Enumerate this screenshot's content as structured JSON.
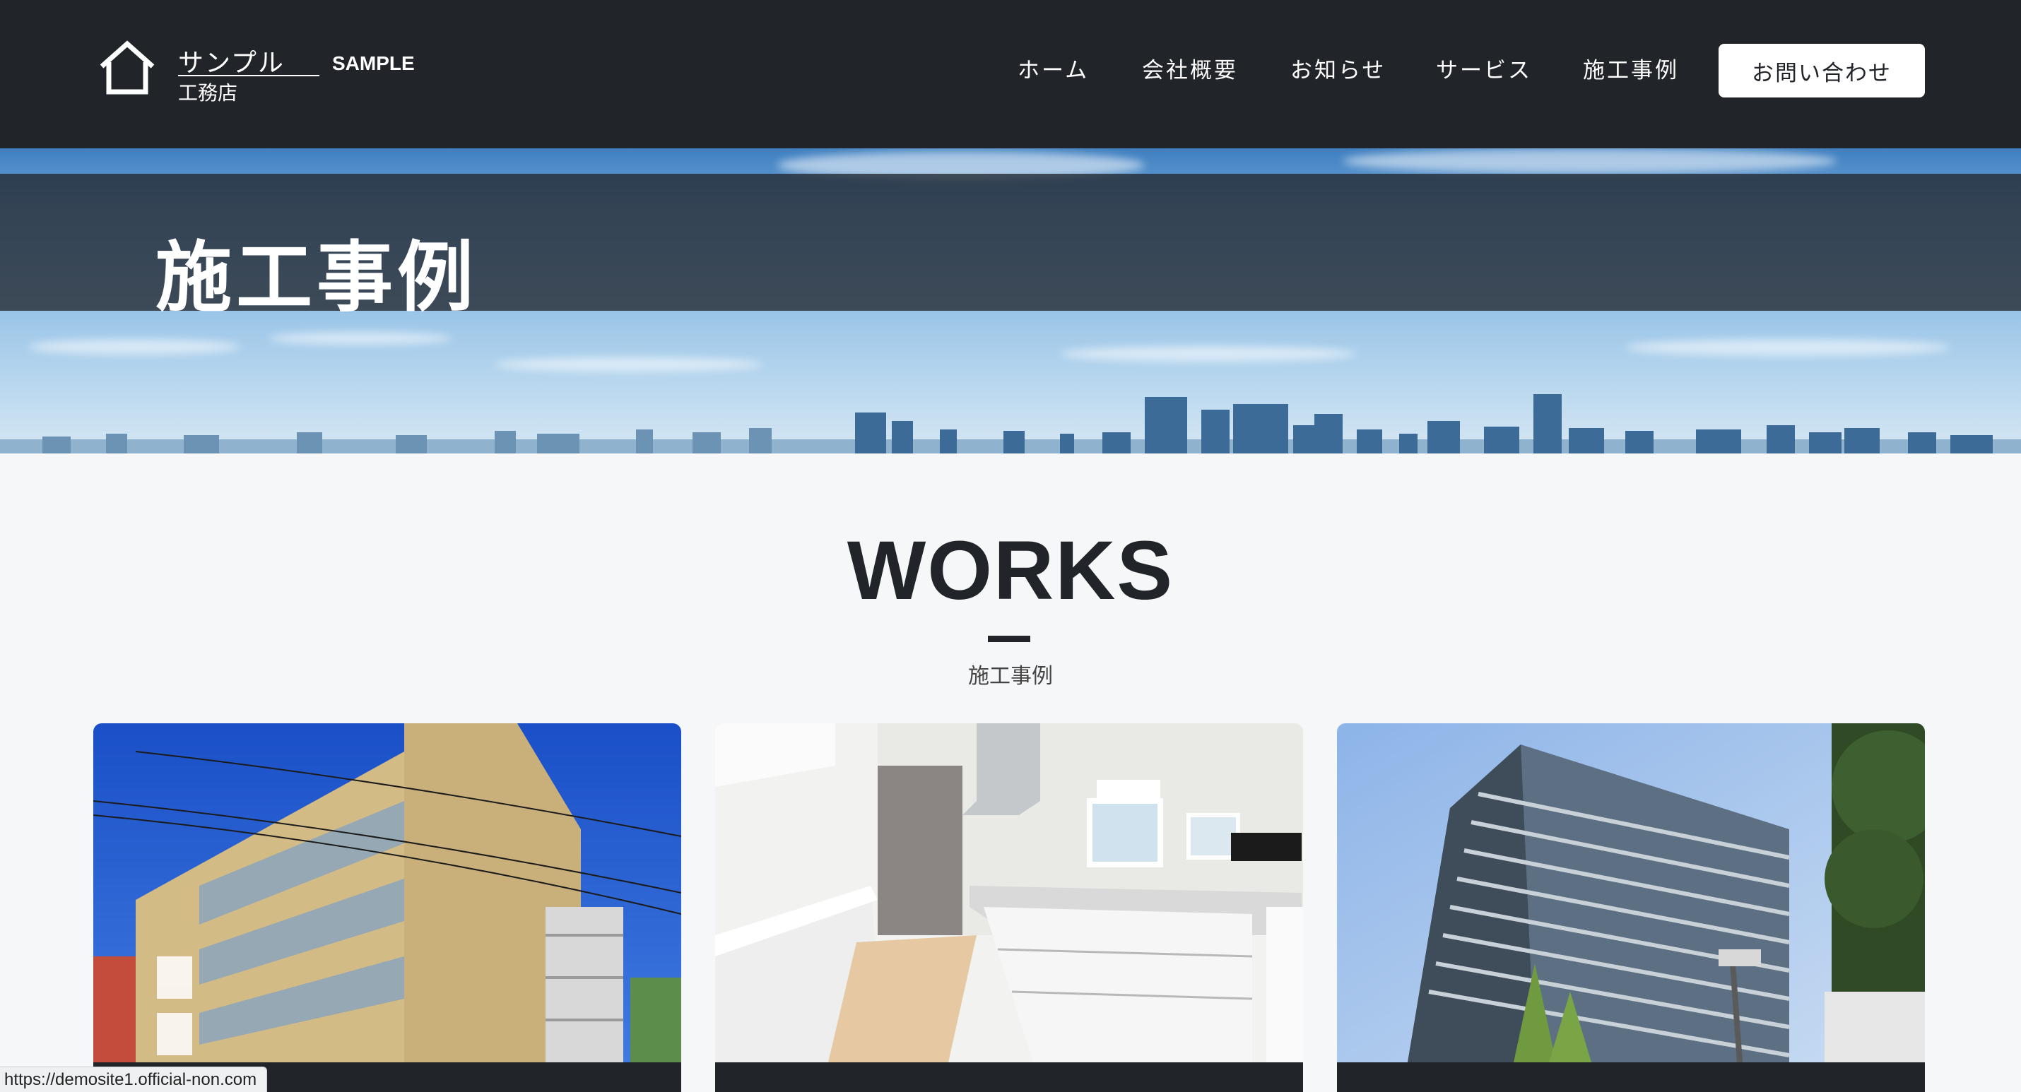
{
  "header": {
    "logo": {
      "name_top": "サンプル",
      "name_bottom": "工務店",
      "name_en": "SAMPLE"
    },
    "nav": [
      {
        "label": "ホーム"
      },
      {
        "label": "会社概要"
      },
      {
        "label": "お知らせ"
      },
      {
        "label": "サービス"
      },
      {
        "label": "施工事例"
      }
    ],
    "contact_label": "お問い合わせ"
  },
  "hero": {
    "title": "施工事例"
  },
  "works": {
    "heading": "WORKS",
    "subheading": "施工事例",
    "cards": [
      {
        "image": "apartment-building-photo"
      },
      {
        "image": "kitchen-interior-photo"
      },
      {
        "image": "office-tower-photo"
      }
    ]
  },
  "status_bar": {
    "url": "https://demosite1.official-non.com"
  },
  "colors": {
    "header_bg": "#212429",
    "page_bg": "#f6f7f9",
    "text_dark": "#212429"
  }
}
